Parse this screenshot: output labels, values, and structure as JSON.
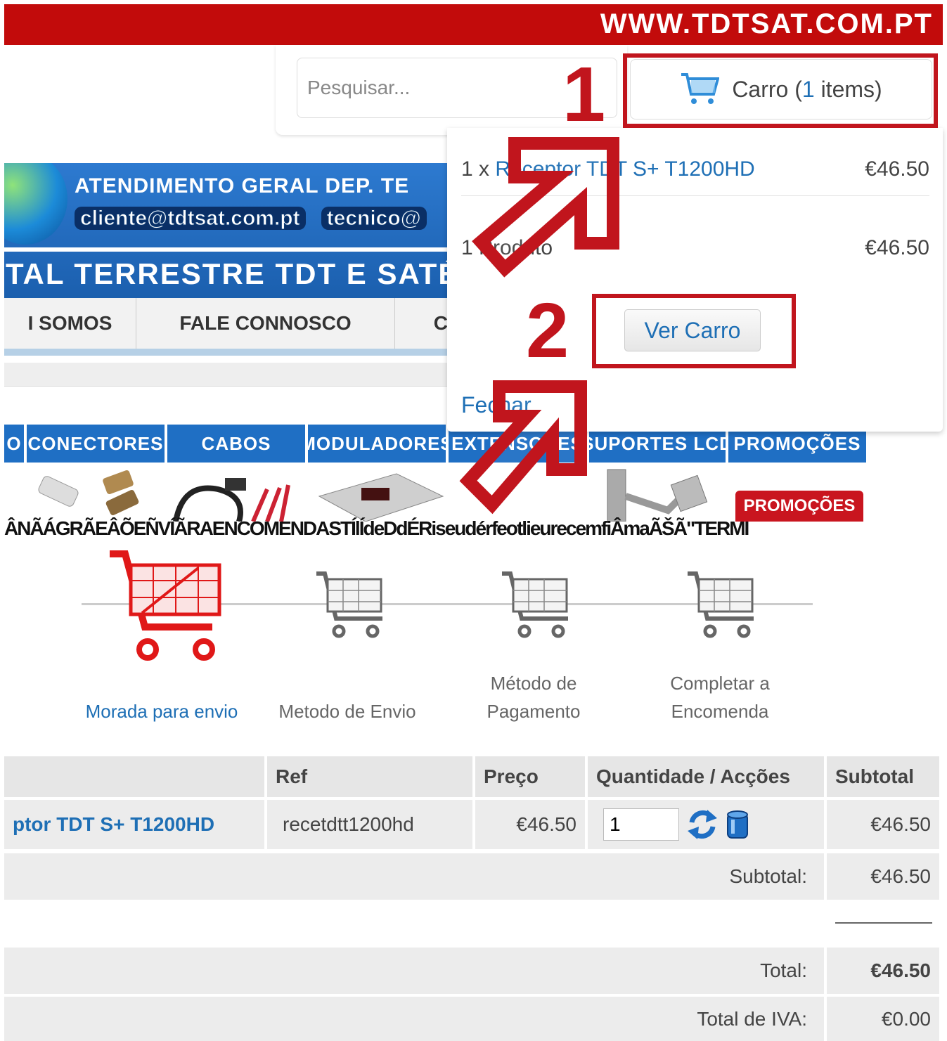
{
  "header": {
    "site_url": "WWW.TDTSAT.COM.PT",
    "search_placeholder": "Pesquisar...",
    "cart_label": "Carro (",
    "cart_count": "1",
    "cart_label_end": " items)"
  },
  "banner": {
    "line1": "ATENDIMENTO GERAL  DEP. TE",
    "email1": "cliente@tdtsat.com.pt",
    "email2": "tecnico@",
    "line3": "TAL TERRESTRE TDT E SATÉ"
  },
  "mainnav": [
    "I SOMOS",
    "FALE CONNOSCO",
    "C"
  ],
  "categories": [
    "O",
    "CONECTORES",
    "CABOS",
    "MODULADORES",
    "EXTENSORES",
    "SUPORTES LCD",
    "PROMOÇÕES"
  ],
  "promo_badge": "PROMOÇÕES",
  "garbled_text": "ÂNÃÁGRÃEÂÕEÑVÍÃRAENCOMENDASTÍlÍdeDdÉRiseudérfeotlieurecemfiÂmaÃŠÃ\"TERMI",
  "dropdown": {
    "item_qty": "1 x",
    "item_name": "Receptor TDT S+ T1200HD",
    "item_price": "€46.50",
    "total_label": "1 Produto",
    "total_price": "€46.50",
    "view_cart": "Ver Carro",
    "close": "Fechar"
  },
  "annotations": {
    "step1": "1",
    "step2": "2",
    "color": "#c1151d"
  },
  "steps": [
    {
      "label": "Morada para envio",
      "active": true
    },
    {
      "label": "Metodo de Envio",
      "active": false
    },
    {
      "label": "Método de Pagamento",
      "active": false
    },
    {
      "label": "Completar a Encomenda",
      "active": false
    }
  ],
  "table": {
    "headers": [
      "",
      "Ref",
      "Preço",
      "Quantidade / Acções",
      "Subtotal"
    ],
    "row": {
      "product": "ptor TDT S+ T1200HD",
      "ref": "recetdtt1200hd",
      "price": "€46.50",
      "qty": "1",
      "subtotal": "€46.50"
    },
    "subtotal_label": "Subtotal:",
    "subtotal_value": "€46.50",
    "total_label": "Total:",
    "total_value": "€46.50",
    "vat_label": "Total de IVA:",
    "vat_value": "€0.00"
  }
}
